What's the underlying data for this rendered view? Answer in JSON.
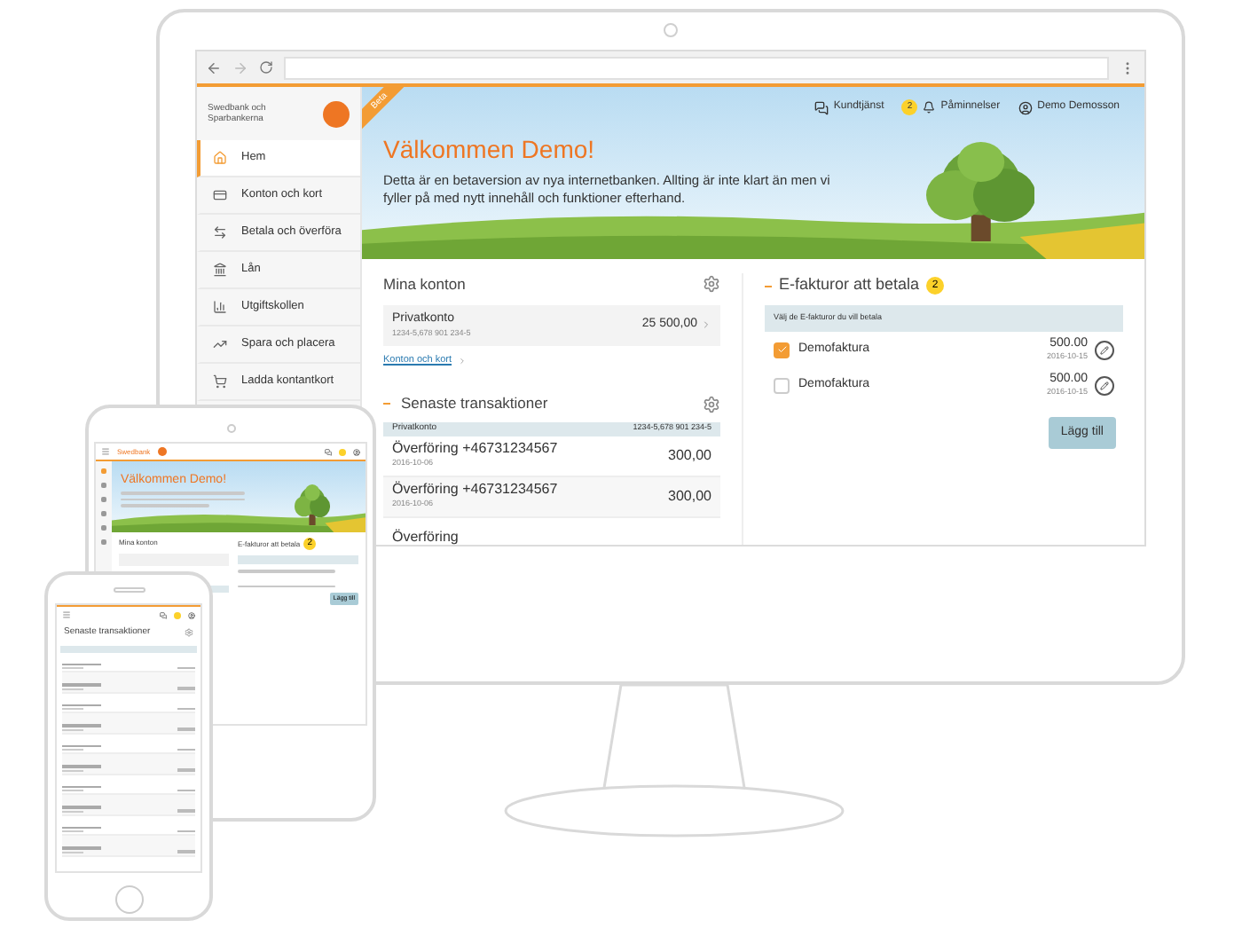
{
  "monitor": {
    "sidebar": {
      "logo_text": "Swedbank och Sparbankerna",
      "items": [
        {
          "label": "Hem",
          "selected": true
        },
        {
          "label": "Konton och kort",
          "selected": false
        },
        {
          "label": "Betala och överföra",
          "selected": false
        },
        {
          "label": "Lån",
          "selected": false
        },
        {
          "label": "Utgiftskollen",
          "selected": false
        },
        {
          "label": "Spara och placera",
          "selected": false
        },
        {
          "label": "Ladda kontantkort",
          "selected": false
        }
      ]
    },
    "banner": {
      "ribbon": "Beta",
      "customer_service": "Kundtjänst",
      "reminders_badge": "2",
      "reminders": "Påminnelser",
      "user": "Demo Demosson",
      "title": "Välkommen Demo!",
      "text": "Detta är en betaversion av nya internetbanken. Allting är inte klart än men vi fyller på med nytt innehåll och funktioner efterhand."
    },
    "accounts": {
      "title": "Mina konton",
      "rows": [
        {
          "name": "Privatkonto",
          "number": "1234-5,678 901 234-5",
          "amount": "25 500,00"
        }
      ],
      "link": "Konton och kort"
    },
    "transactions": {
      "title": "Senaste transaktioner",
      "header": {
        "account": "Privatkonto",
        "number": "1234-5,678 901 234-5"
      },
      "rows": [
        {
          "name": "Överföring +46731234567",
          "date": "2016-10-06",
          "amount": "300,00"
        },
        {
          "name": "Överföring +46731234567",
          "date": "2016-10-06",
          "amount": "300,00"
        },
        {
          "name": "Överföring"
        }
      ]
    },
    "einvoices": {
      "title": "E-fakturor att betala",
      "badge": "2",
      "hint": "Välj de E-fakturor du vill betala",
      "rows": [
        {
          "name": "Demofaktura",
          "amount": "500.00",
          "date": "2016-10-15",
          "checked": true
        },
        {
          "name": "Demofaktura",
          "amount": "500.00",
          "date": "2016-10-15",
          "checked": false
        }
      ],
      "button": "Lägg till"
    }
  },
  "tablet": {
    "logo": "Swedbank",
    "title": "Välkommen Demo!",
    "accounts_title": "Mina konton",
    "einvoices_title": "E-fakturor att betala",
    "badge": "2",
    "button": "Lägg till"
  },
  "phone": {
    "section_title": "Senaste transaktioner"
  }
}
